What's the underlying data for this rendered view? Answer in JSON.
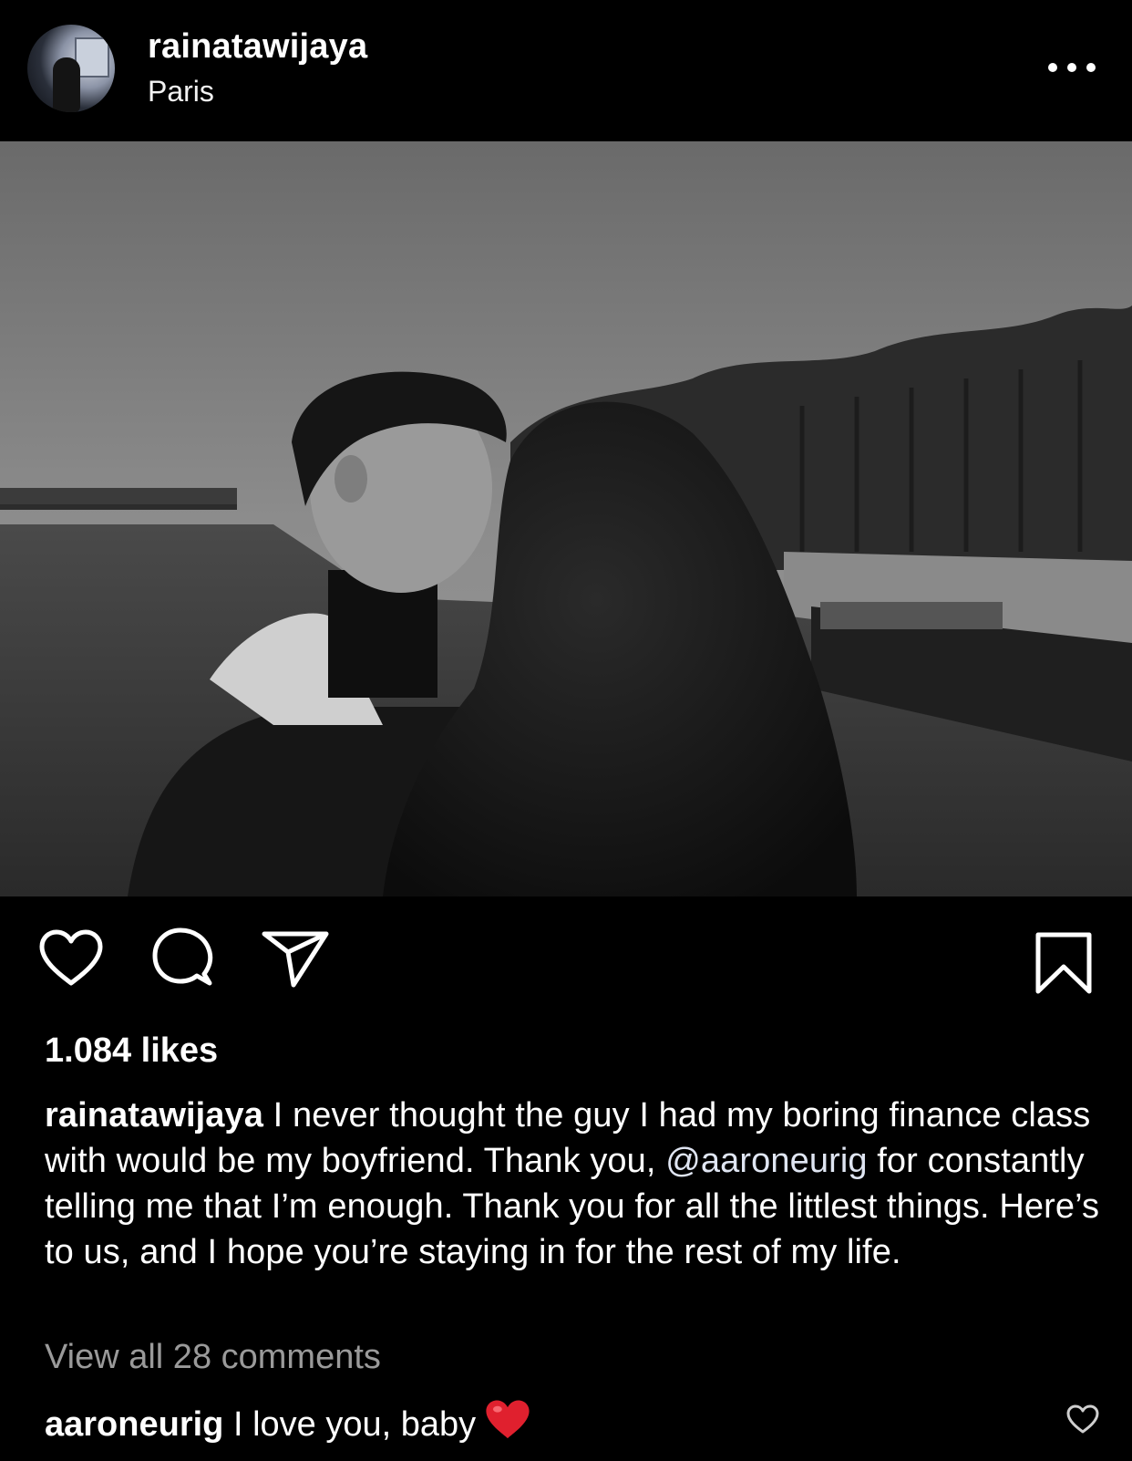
{
  "post": {
    "username": "rainatawijaya",
    "location": "Paris",
    "more_icon": "more-horizontal-icon"
  },
  "actions": {
    "like_icon": "heart-outline-icon",
    "comment_icon": "comment-bubble-icon",
    "share_icon": "paper-plane-icon",
    "save_icon": "bookmark-outline-icon"
  },
  "likes_text": "1.084 likes",
  "caption": {
    "user": "rainatawijaya",
    "text_1": " I never thought the guy I had my boring finance class with would be my boyfriend. Thank you, ",
    "mention": "@aaroneurig",
    "text_2": " for constantly telling me that I’m enough. Thank you for all the littlest things. Here’s to us, and I hope you’re staying in for the rest of my life."
  },
  "view_all_comments": "View all 28 comments",
  "comment": {
    "user": "aaroneurig",
    "text": " I love you, baby",
    "emoji_icon": "red-heart-emoji-icon",
    "like_icon": "heart-outline-small-icon"
  },
  "colors": {
    "background": "#000000",
    "text": "#ffffff",
    "muted": "#9a9a9a",
    "emoji_red": "#e0202e"
  }
}
